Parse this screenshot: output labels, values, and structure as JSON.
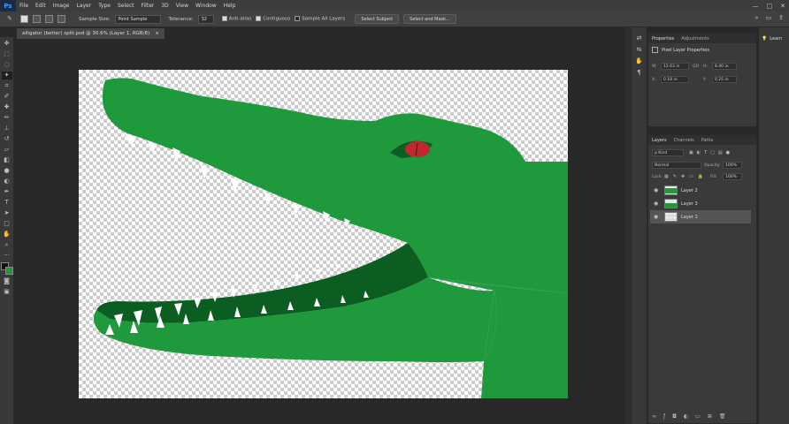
{
  "menubar": {
    "logo": "Ps",
    "items": [
      "File",
      "Edit",
      "Image",
      "Layer",
      "Type",
      "Select",
      "Filter",
      "3D",
      "View",
      "Window",
      "Help"
    ]
  },
  "options": {
    "sample_size_label": "Sample Size:",
    "sample_size_value": "Point Sample",
    "tolerance_label": "Tolerance:",
    "tolerance_value": "32",
    "antialias_label": "Anti-alias",
    "contiguous_label": "Contiguous",
    "sample_all_label": "Sample All Layers",
    "select_subject": "Select Subject",
    "select_mask": "Select and Mask..."
  },
  "document": {
    "tab_title": "alligator (better) split.psd @ 30.6% (Layer 1, RGB/8)",
    "close": "×"
  },
  "properties": {
    "tabs": [
      "Properties",
      "Adjustments"
    ],
    "heading": "Pixel Layer Properties",
    "w_label": "W:",
    "w_value": "12.63 in",
    "go_label": "GO",
    "h_label": "H:",
    "h_value": "8.40 in",
    "x_label": "X:",
    "x_value": "0.18 in",
    "y_label": "Y:",
    "y_value": "0.25 in"
  },
  "layers": {
    "tabs": [
      "Layers",
      "Channels",
      "Paths"
    ],
    "filter": "ρ Kind",
    "blend_mode": "Normal",
    "opacity_label": "Opacity:",
    "opacity_value": "100%",
    "lock_label": "Lock:",
    "fill_label": "Fill:",
    "fill_value": "100%",
    "items": [
      {
        "name": "Layer 2",
        "selected": false
      },
      {
        "name": "Layer 3",
        "selected": false
      },
      {
        "name": "Layer 1",
        "selected": true
      }
    ]
  },
  "learn": {
    "label": "Learn"
  },
  "colors": {
    "gator": "#1e9a3d",
    "mouth": "#0c5d22",
    "eye": "#c0282d",
    "panel": "#3a3a3a"
  }
}
